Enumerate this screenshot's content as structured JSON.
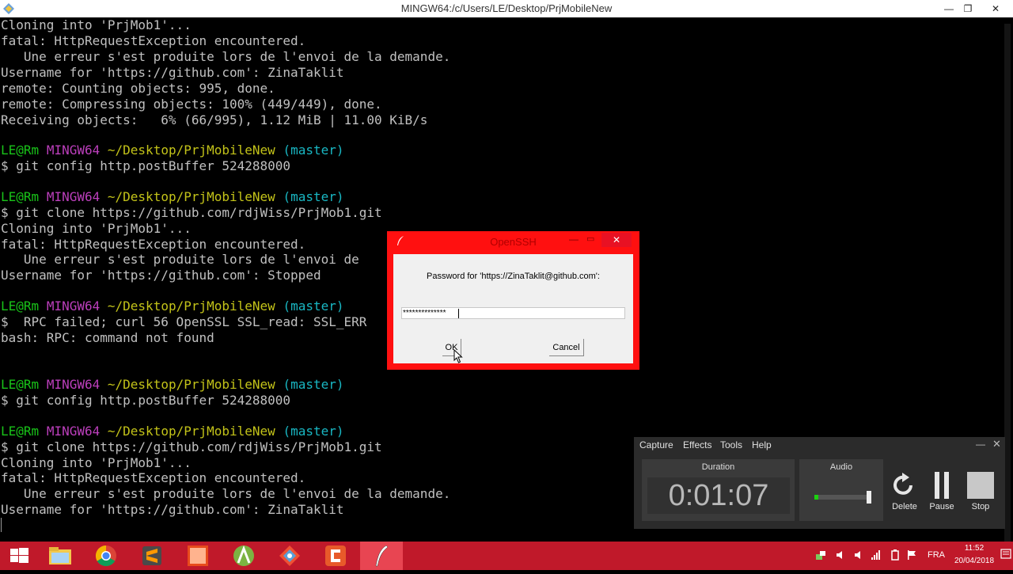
{
  "window": {
    "title": "MINGW64:/c/Users/LE/Desktop/PrjMobileNew",
    "minimize": "—",
    "maximize": "❐",
    "close": "✕"
  },
  "terminal": {
    "colors": {
      "prompt_user": "#19c319",
      "prompt_host": "#bc3fbc",
      "prompt_path": "#c3c319",
      "prompt_branch": "#19b7c3",
      "text": "#c0c0c0"
    },
    "lines": {
      "l0": "Cloning into 'PrjMob1'...",
      "l1": "fatal: HttpRequestException encountered.",
      "l2": "   Une erreur s'est produite lors de l'envoi de la demande.",
      "l3": "Username for 'https://github.com': ZinaTaklit",
      "l4": "remote: Counting objects: 995, done.",
      "l5": "remote: Compressing objects: 100% (449/449), done.",
      "l6": "Receiving objects:   6% (66/995), 1.12 MiB | 11.00 KiB/s",
      "l8_user": "LE@Rm",
      "l8_host": "MINGW64",
      "l8_path": "~/Desktop/PrjMobileNew",
      "l8_branch": "(master)",
      "l9": "$ git config http.postBuffer 524288000",
      "l11_user": "LE@Rm",
      "l11_host": "MINGW64",
      "l11_path": "~/Desktop/PrjMobileNew",
      "l11_branch": "(master)",
      "l12": "$ git clone https://github.com/rdjWiss/PrjMob1.git",
      "l13": "Cloning into 'PrjMob1'...",
      "l14": "fatal: HttpRequestException encountered.",
      "l15": "   Une erreur s'est produite lors de l'envoi de",
      "l16": "Username for 'https://github.com': Stopped",
      "l18_user": "LE@Rm",
      "l18_host": "MINGW64",
      "l18_path": "~/Desktop/PrjMobileNew",
      "l18_branch": "(master)",
      "l19": "$  RPC failed; curl 56 OpenSSL SSL_read: SSL_ERR",
      "l20": "bash: RPC: command not found",
      "l23_user": "LE@Rm",
      "l23_host": "MINGW64",
      "l23_path": "~/Desktop/PrjMobileNew",
      "l23_branch": "(master)",
      "l24": "$ git config http.postBuffer 524288000",
      "l26_user": "LE@Rm",
      "l26_host": "MINGW64",
      "l26_path": "~/Desktop/PrjMobileNew",
      "l26_branch": "(master)",
      "l27": "$ git clone https://github.com/rdjWiss/PrjMob1.git",
      "l28": "Cloning into 'PrjMob1'...",
      "l29": "fatal: HttpRequestException encountered.",
      "l30": "   Une erreur s'est produite lors de l'envoi de la demande.",
      "l31": "Username for 'https://github.com': ZinaTaklit"
    }
  },
  "dialog": {
    "title": "OpenSSH",
    "prompt": "Password for 'https://ZinaTaklit@github.com':",
    "password_value": "**************",
    "ok_label": "OK",
    "cancel_label": "Cancel",
    "minimize": "—",
    "maximize": "▭",
    "close": "✕",
    "accent_color": "#ff1010"
  },
  "recorder": {
    "menu": {
      "capture": "Capture",
      "effects": "Effects",
      "tools": "Tools",
      "help": "Help"
    },
    "minimize": "—",
    "close": "✕",
    "duration_label": "Duration",
    "duration": "0:01:07",
    "audio_label": "Audio",
    "audio_level": 0.07,
    "delete_label": "Delete",
    "pause_label": "Pause",
    "stop_label": "Stop"
  },
  "taskbar": {
    "color": "#c0192a",
    "apps": [
      "windows-start",
      "file-explorer",
      "chrome",
      "sublime-text",
      "pdf-reader",
      "android-studio",
      "git-gui",
      "camtasia",
      "git-bash-openssh"
    ],
    "language": "FRA",
    "time": "11:52",
    "date": "20/04/2018"
  }
}
